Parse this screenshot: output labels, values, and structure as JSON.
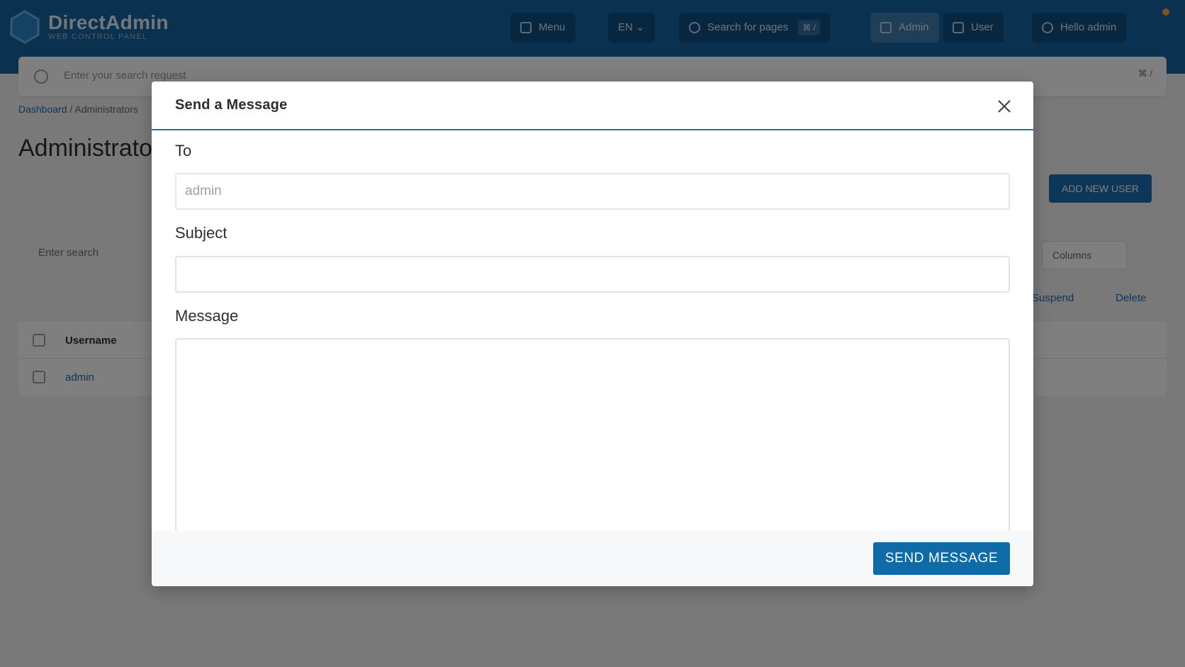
{
  "app": {
    "brand": "DirectAdmin",
    "brand_sub": "WEB CONTROL PANEL",
    "nav": {
      "menu": "Menu",
      "lang": "EN",
      "search": "Search for pages",
      "search_kbd": "⌘ /",
      "admin": "Admin",
      "user": "User",
      "account": "Hello admin"
    },
    "global_search": {
      "placeholder": "Enter your search request",
      "kbd": "⌘ /"
    },
    "breadcrumb": {
      "home": "Dashboard",
      "current": "Administrators"
    },
    "page_title": "Administrators",
    "buttons": {
      "create": "ADD NEW USER"
    },
    "filter": {
      "placeholder": "Enter search"
    },
    "columns_select": "Columns",
    "links": {
      "suspend": "Suspend",
      "delete": "Delete"
    },
    "table": {
      "header_username": "Username",
      "rows": [
        "admin"
      ]
    },
    "colors": {
      "topbar": "#14639e",
      "accent": "#0f6aa8",
      "header_line": "#1a6fb0"
    }
  },
  "modal": {
    "title": "Send a Message",
    "to_label": "To",
    "to_value": "admin",
    "subject_label": "Subject",
    "subject_value": "",
    "message_label": "Message",
    "message_value": "",
    "send_label": "SEND MESSAGE",
    "close_icon": "close-icon"
  }
}
